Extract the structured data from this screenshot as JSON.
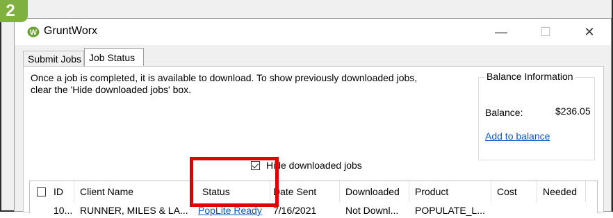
{
  "step_badge": "2",
  "window": {
    "title": "GruntWorx",
    "min_glyph": "—",
    "max_glyph": "☐",
    "close_glyph": "✕"
  },
  "tabs": [
    {
      "label": "Submit Jobs",
      "selected": false
    },
    {
      "label": "Job Status",
      "selected": true
    }
  ],
  "intro_text": "Once a job is completed, it is available to download.  To show previously downloaded jobs, clear the 'Hide downloaded jobs' box.",
  "balance": {
    "title": "Balance Information",
    "label": "Balance:",
    "value": "$236.05",
    "add_link": "Add to balance"
  },
  "hide_downloaded": {
    "label": "Hide downloaded jobs",
    "checked": true
  },
  "table": {
    "columns": [
      "ID",
      "Client Name",
      "Status",
      "Date Sent",
      "Downloaded",
      "Product",
      "Cost",
      "Needed"
    ],
    "rows": [
      {
        "id": "10...",
        "client": "RUNNER, MILES & LA...",
        "status": "PopLite Ready",
        "date": "7/16/2021",
        "downloaded": "Not Downl...",
        "product": "POPULATE_L...",
        "cost": "",
        "needed": ""
      }
    ]
  },
  "colors": {
    "highlight": "#e00000",
    "badge": "#80b040",
    "link": "#0a56c8"
  }
}
